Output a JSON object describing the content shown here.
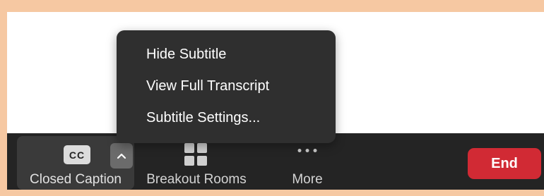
{
  "caption_menu": {
    "items": [
      {
        "label": "Hide Subtitle"
      },
      {
        "label": "View Full Transcript"
      },
      {
        "label": "Subtitle Settings..."
      }
    ]
  },
  "toolbar": {
    "closed_caption": {
      "badge": "CC",
      "label": "Closed Caption",
      "caret_icon": "chevron-up-icon"
    },
    "breakout_rooms": {
      "label": "Breakout Rooms",
      "icon": "grid-icon"
    },
    "more": {
      "label": "More",
      "icon": "ellipsis-icon"
    },
    "end": {
      "label": "End"
    }
  },
  "colors": {
    "frame_border": "#f6c8a2",
    "toolbar_bg": "#242424",
    "menu_bg": "#2f2f2f",
    "end_button": "#d12a34"
  }
}
